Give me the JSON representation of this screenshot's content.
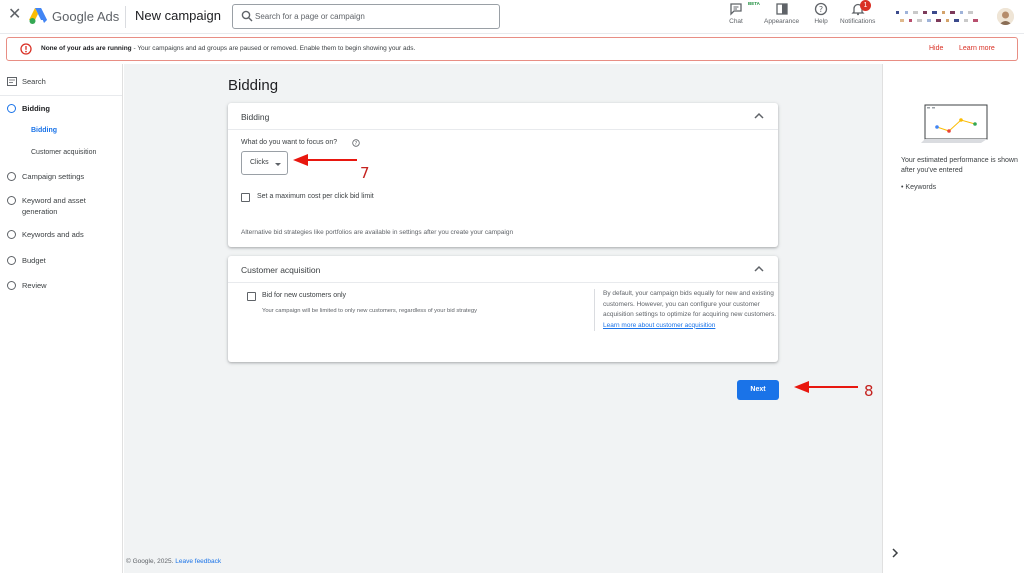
{
  "header": {
    "brand": "Google Ads",
    "page_title": "New campaign",
    "search_placeholder": "Search for a page or campaign",
    "buttons": {
      "chat": "Chat",
      "chat_badge": "BETA",
      "appearance": "Appearance",
      "help": "Help",
      "notifications": "Notifications",
      "notifications_count": "1"
    }
  },
  "alert": {
    "title": "None of your ads are running",
    "message": " - Your campaigns and ad groups are paused or removed. Enable them to begin showing your ads.",
    "hide": "Hide",
    "learn_more": "Learn more"
  },
  "sidebar": {
    "search": "Search",
    "items": [
      {
        "label": "Bidding",
        "active": true
      },
      {
        "label": "Campaign settings"
      },
      {
        "label": "Keyword and asset generation"
      },
      {
        "label": "Keywords and ads"
      },
      {
        "label": "Budget"
      },
      {
        "label": "Review"
      }
    ],
    "subitems": [
      {
        "label": "Bidding",
        "active": true
      },
      {
        "label": "Customer acquisition"
      }
    ]
  },
  "main": {
    "title": "Bidding",
    "bidding_card": {
      "title": "Bidding",
      "question": "What do you want to focus on?",
      "focus_value": "Clicks",
      "max_cpc_label": "Set a maximum cost per click bid limit",
      "note": "Alternative bid strategies like portfolios are available in settings after you create your campaign"
    },
    "acquisition_card": {
      "title": "Customer acquisition",
      "checkbox_label": "Bid for new customers only",
      "checkbox_note": "Your campaign will be limited to only new customers, regardless of your bid strategy",
      "help_text": "By default, your campaign bids equally for new and existing customers. However, you can configure your customer acquisition settings to optimize for acquiring new customers. ",
      "help_link": "Learn more about customer acquisition"
    },
    "next_button": "Next",
    "footer_copy": "© Google, 2025. ",
    "footer_link": "Leave feedback"
  },
  "right_panel": {
    "text": "Your estimated performance is shown after you've entered",
    "bullet": "Keywords"
  },
  "annotations": {
    "step_7": "7",
    "step_8": "8"
  },
  "colors": {
    "accent": "#1a73e8",
    "alert": "#d93025",
    "annotation": "#e8170f"
  }
}
